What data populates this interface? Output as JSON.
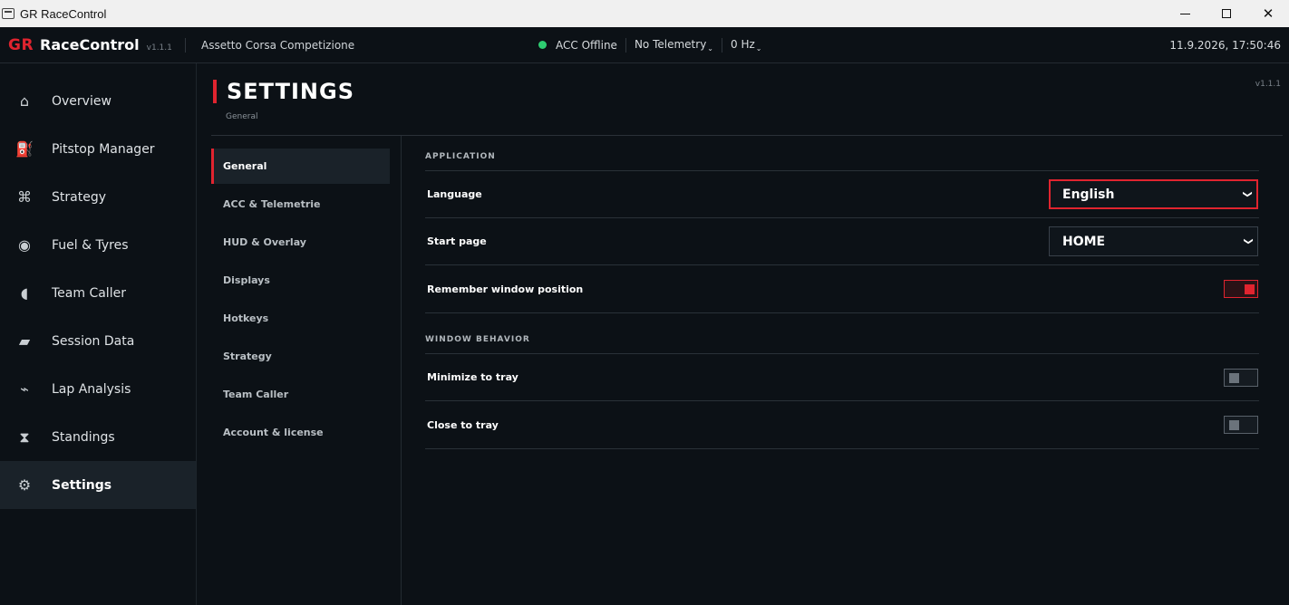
{
  "window": {
    "title": "GR RaceControl",
    "minimize_glyph": "—",
    "close_glyph": "✕"
  },
  "header": {
    "brand_gr": "GR",
    "brand_name": "RaceControl",
    "version": "v1.1.1",
    "game": "Assetto Corsa Competizione",
    "status_dot_color": "#2ecc71",
    "acc_status": "ACC Offline",
    "telemetry": "No Telemetry",
    "rate": "0 Hz",
    "datetime": "11.9.2026, 17:50:46"
  },
  "sidebar": {
    "items": [
      {
        "label": "Overview",
        "icon": "home-icon",
        "glyph": "⌂"
      },
      {
        "label": "Pitstop Manager",
        "icon": "fuel-pump-icon",
        "glyph": "⛽"
      },
      {
        "label": "Strategy",
        "icon": "command-icon",
        "glyph": "⌘"
      },
      {
        "label": "Fuel & Tyres",
        "icon": "tyre-icon",
        "glyph": "◉"
      },
      {
        "label": "Team Caller",
        "icon": "half-circle-icon",
        "glyph": "◖"
      },
      {
        "label": "Session Data",
        "icon": "parallelogram-icon",
        "glyph": "▰"
      },
      {
        "label": "Lap Analysis",
        "icon": "wave-icon",
        "glyph": "⌁"
      },
      {
        "label": "Standings",
        "icon": "hourglass-icon",
        "glyph": "⧗"
      },
      {
        "label": "Settings",
        "icon": "gear-icon",
        "glyph": "⚙"
      }
    ],
    "active": "Settings"
  },
  "page": {
    "title": "SETTINGS",
    "subtitle": "General",
    "corner_version": "v1.1.1"
  },
  "subnav": {
    "items": [
      "General",
      "ACC & Telemetrie",
      "HUD & Overlay",
      "Displays",
      "Hotkeys",
      "Strategy",
      "Team Caller",
      "Account & license"
    ],
    "active": "General"
  },
  "settings": {
    "application": {
      "heading": "APPLICATION",
      "language_label": "Language",
      "language_value": "English",
      "start_page_label": "Start page",
      "start_page_value": "HOME",
      "remember_label": "Remember window position",
      "remember_on": true
    },
    "window_behavior": {
      "heading": "WINDOW BEHAVIOR",
      "minimize_label": "Minimize to tray",
      "minimize_on": false,
      "close_label": "Close to tray",
      "close_on": false
    }
  },
  "colors": {
    "accent": "#e0242f",
    "background": "#0c1116",
    "active_bg": "#1a2229"
  }
}
